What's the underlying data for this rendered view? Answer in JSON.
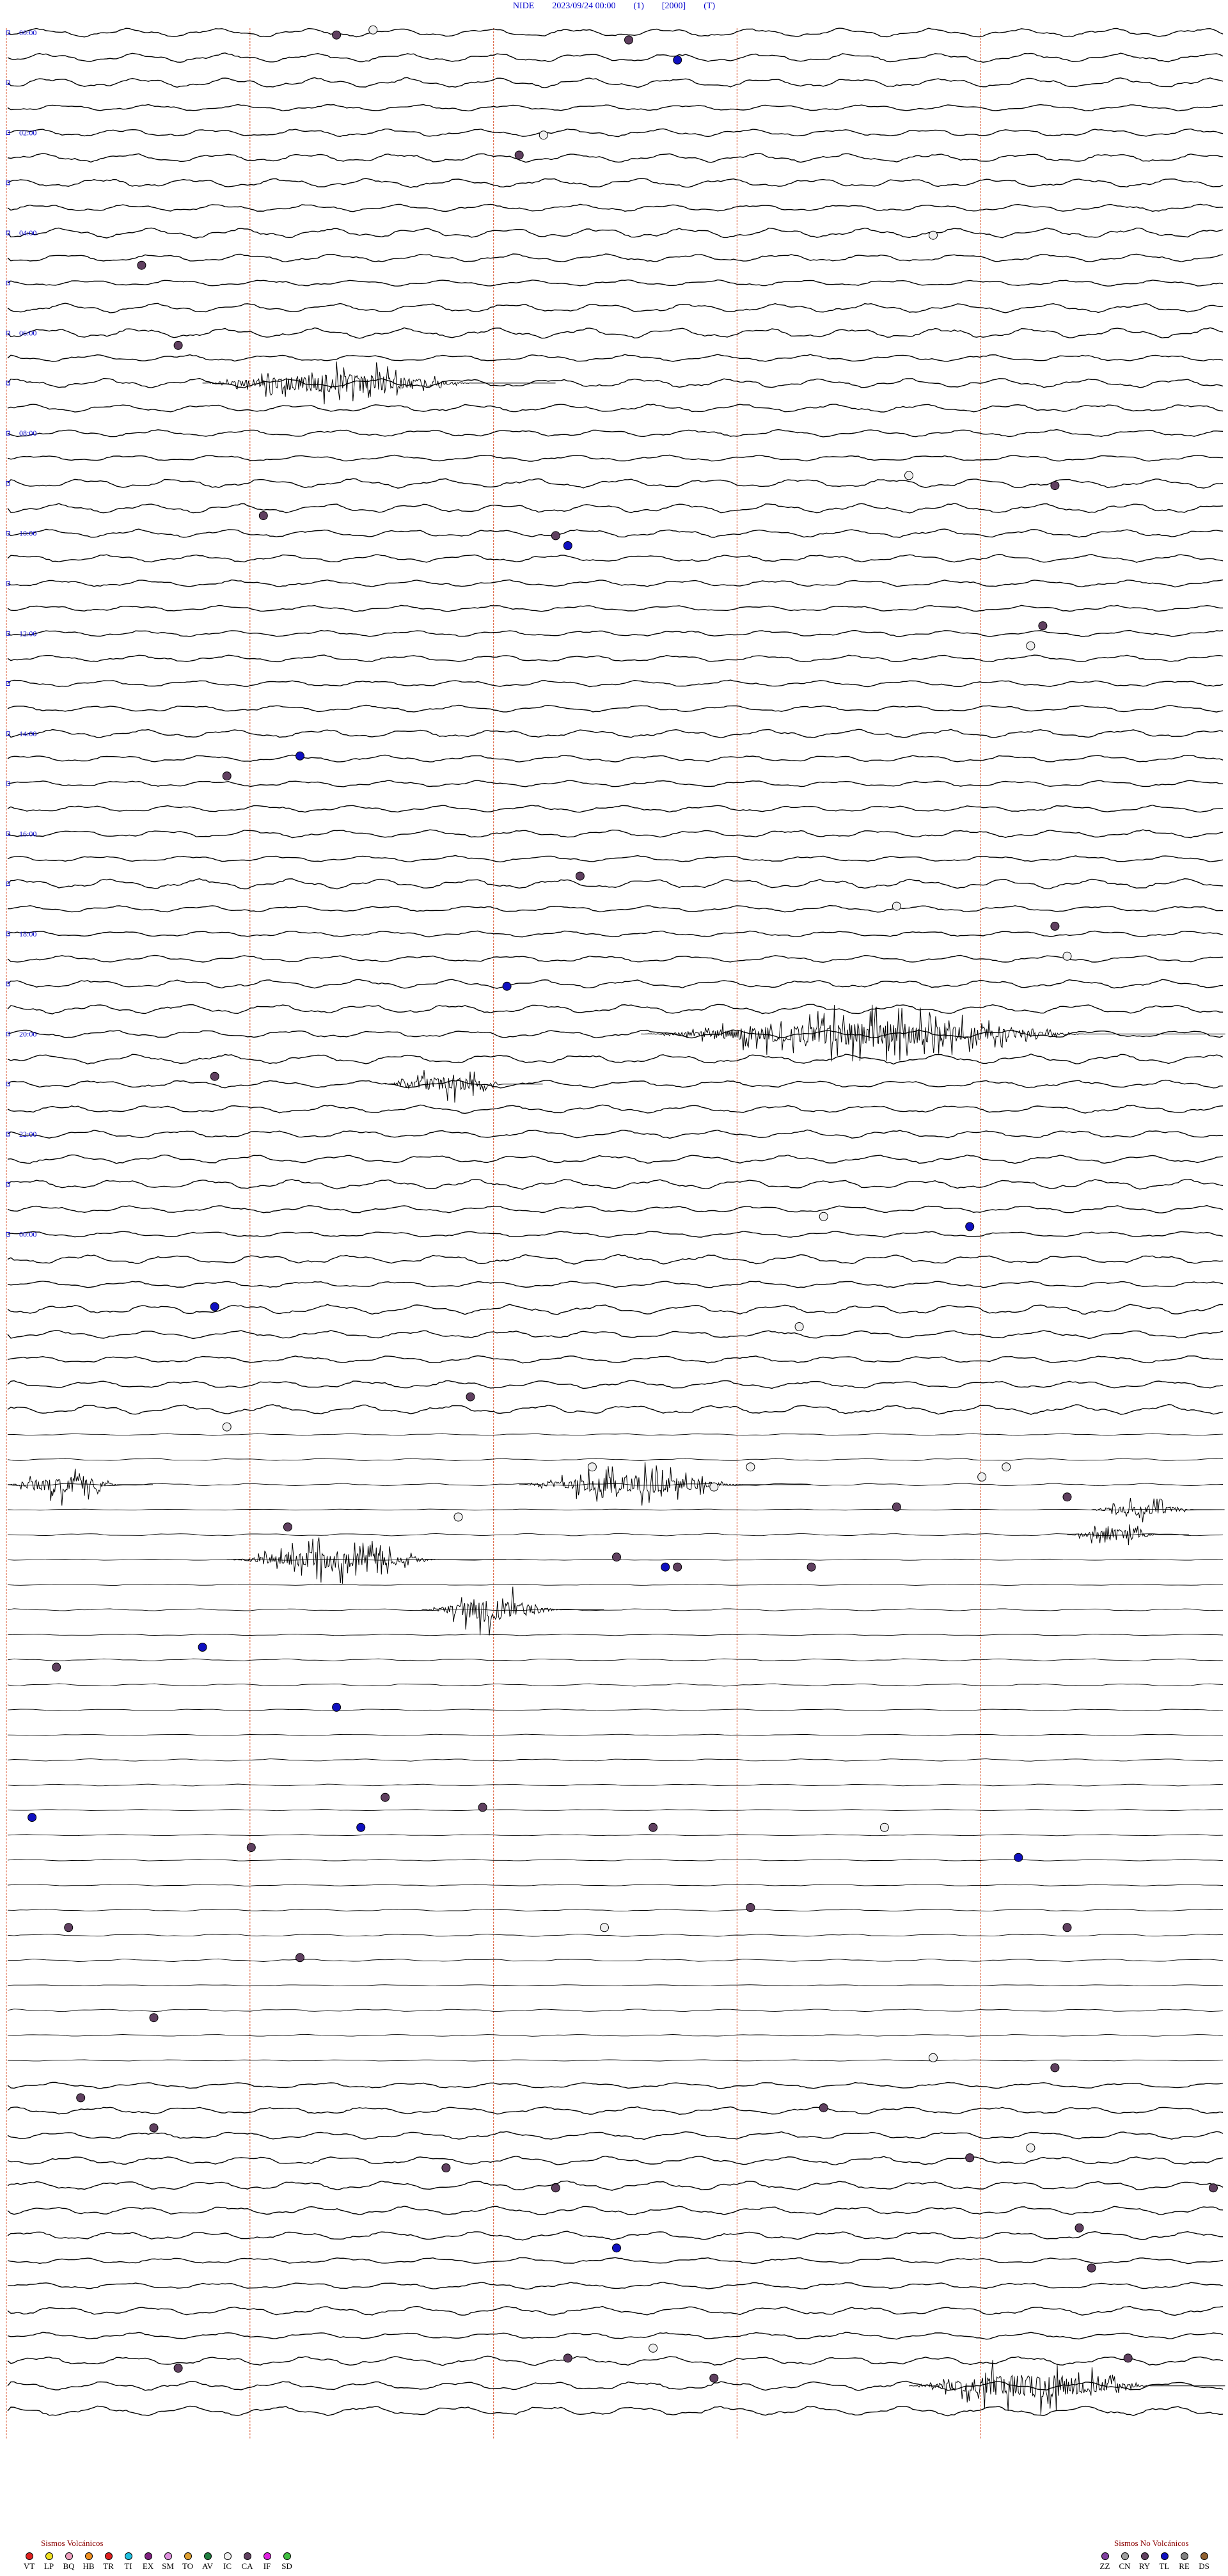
{
  "header": {
    "station": "NIDE",
    "datetime": "2023/09/24 00:00",
    "channel": "(1)",
    "gain": "[2000]",
    "scale": "(T)"
  },
  "colors": {
    "hour_label": "#0000cc",
    "trace": "#000000",
    "minute_guides": "#e07050",
    "legend_title": "#8b0000"
  },
  "chart_data": {
    "type": "helicorder",
    "start": "2023/09/24 00:00",
    "hours": 24,
    "traces_per_hour": 4,
    "hour_labels": [
      "00:00",
      "02:00",
      "04:00",
      "06:00",
      "08:00",
      "10:00",
      "12:00",
      "14:00",
      "16:00",
      "18:00",
      "20:00",
      "22:00",
      "00:00"
    ],
    "minute_guides_fraction": [
      0.0,
      0.2,
      0.4,
      0.6,
      0.8
    ],
    "trace_amplitude_segments": [
      {
        "hours": [
          0,
          14
        ],
        "level": "high"
      },
      {
        "hours": [
          14,
          20.5
        ],
        "level": "low"
      },
      {
        "hours": [
          20.5,
          24
        ],
        "level": "high"
      }
    ],
    "bursts": [
      {
        "trace": 14,
        "from": 0.16,
        "to": 0.45,
        "amp": 40
      },
      {
        "trace": 40,
        "from": 0.52,
        "to": 1.0,
        "amp": 48
      },
      {
        "trace": 42,
        "from": 0.31,
        "to": 0.44,
        "amp": 30
      },
      {
        "trace": 58,
        "from": 0.0,
        "to": 0.12,
        "amp": 36
      },
      {
        "trace": 58,
        "from": 0.42,
        "to": 0.66,
        "amp": 40
      },
      {
        "trace": 59,
        "from": 0.89,
        "to": 1.0,
        "amp": 22
      },
      {
        "trace": 60,
        "from": 0.87,
        "to": 0.97,
        "amp": 24
      },
      {
        "trace": 61,
        "from": 0.18,
        "to": 0.41,
        "amp": 38
      },
      {
        "trace": 63,
        "from": 0.34,
        "to": 0.49,
        "amp": 44
      },
      {
        "trace": 94,
        "from": 0.74,
        "to": 1.0,
        "amp": 50
      }
    ],
    "event_markers": [
      {
        "hour": 0.1,
        "pos": 0.27,
        "type": "CA"
      },
      {
        "hour": 0.05,
        "pos": 0.3,
        "type": "IC"
      },
      {
        "hour": 0.15,
        "pos": 0.51,
        "type": "CA"
      },
      {
        "hour": 0.35,
        "pos": 0.55,
        "type": "TL"
      },
      {
        "hour": 1.1,
        "pos": 0.44,
        "type": "IC"
      },
      {
        "hour": 1.3,
        "pos": 0.42,
        "type": "CA"
      },
      {
        "hour": 2.1,
        "pos": 0.76,
        "type": "IC"
      },
      {
        "hour": 2.4,
        "pos": 0.11,
        "type": "CA"
      },
      {
        "hour": 3.2,
        "pos": 0.14,
        "type": "CA"
      },
      {
        "hour": 4.5,
        "pos": 0.74,
        "type": "IC"
      },
      {
        "hour": 4.6,
        "pos": 0.86,
        "type": "CA"
      },
      {
        "hour": 4.9,
        "pos": 0.21,
        "type": "CA"
      },
      {
        "hour": 5.1,
        "pos": 0.45,
        "type": "CA"
      },
      {
        "hour": 5.2,
        "pos": 0.46,
        "type": "TL"
      },
      {
        "hour": 6.0,
        "pos": 0.85,
        "type": "CA"
      },
      {
        "hour": 6.2,
        "pos": 0.84,
        "type": "IC"
      },
      {
        "hour": 7.3,
        "pos": 0.24,
        "type": "TL"
      },
      {
        "hour": 7.5,
        "pos": 0.18,
        "type": "CA"
      },
      {
        "hour": 8.5,
        "pos": 0.47,
        "type": "CA"
      },
      {
        "hour": 8.8,
        "pos": 0.73,
        "type": "IC"
      },
      {
        "hour": 9.0,
        "pos": 0.86,
        "type": "CA"
      },
      {
        "hour": 9.3,
        "pos": 0.87,
        "type": "IC"
      },
      {
        "hour": 9.6,
        "pos": 0.41,
        "type": "TL"
      },
      {
        "hour": 10.5,
        "pos": 0.17,
        "type": "CA"
      },
      {
        "hour": 11.9,
        "pos": 0.67,
        "type": "IC"
      },
      {
        "hour": 12.0,
        "pos": 0.79,
        "type": "TL"
      },
      {
        "hour": 12.8,
        "pos": 0.17,
        "type": "TL"
      },
      {
        "hour": 13.0,
        "pos": 0.65,
        "type": "IC"
      },
      {
        "hour": 13.7,
        "pos": 0.38,
        "type": "CA"
      },
      {
        "hour": 14.0,
        "pos": 0.18,
        "type": "IC"
      },
      {
        "hour": 14.4,
        "pos": 0.48,
        "type": "IC"
      },
      {
        "hour": 14.4,
        "pos": 0.61,
        "type": "IC"
      },
      {
        "hour": 14.5,
        "pos": 0.8,
        "type": "IC"
      },
      {
        "hour": 14.4,
        "pos": 0.82,
        "type": "IC"
      },
      {
        "hour": 14.6,
        "pos": 0.58,
        "type": "IC"
      },
      {
        "hour": 14.7,
        "pos": 0.87,
        "type": "CA"
      },
      {
        "hour": 14.8,
        "pos": 0.73,
        "type": "CA"
      },
      {
        "hour": 14.9,
        "pos": 0.37,
        "type": "IC"
      },
      {
        "hour": 15.0,
        "pos": 0.23,
        "type": "CA"
      },
      {
        "hour": 15.3,
        "pos": 0.5,
        "type": "CA"
      },
      {
        "hour": 15.4,
        "pos": 0.55,
        "type": "CA"
      },
      {
        "hour": 15.4,
        "pos": 0.66,
        "type": "CA"
      },
      {
        "hour": 15.4,
        "pos": 0.54,
        "type": "TL"
      },
      {
        "hour": 16.2,
        "pos": 0.16,
        "type": "TL"
      },
      {
        "hour": 16.4,
        "pos": 0.04,
        "type": "CA"
      },
      {
        "hour": 16.8,
        "pos": 0.27,
        "type": "TL"
      },
      {
        "hour": 17.7,
        "pos": 0.31,
        "type": "CA"
      },
      {
        "hour": 17.8,
        "pos": 0.39,
        "type": "CA"
      },
      {
        "hour": 17.9,
        "pos": 0.02,
        "type": "TL"
      },
      {
        "hour": 18.0,
        "pos": 0.29,
        "type": "TL"
      },
      {
        "hour": 18.0,
        "pos": 0.72,
        "type": "IC"
      },
      {
        "hour": 18.0,
        "pos": 0.53,
        "type": "CA"
      },
      {
        "hour": 18.2,
        "pos": 0.2,
        "type": "CA"
      },
      {
        "hour": 18.3,
        "pos": 0.83,
        "type": "TL"
      },
      {
        "hour": 18.8,
        "pos": 0.61,
        "type": "CA"
      },
      {
        "hour": 19.0,
        "pos": 0.49,
        "type": "IC"
      },
      {
        "hour": 19.0,
        "pos": 0.05,
        "type": "CA"
      },
      {
        "hour": 19.0,
        "pos": 0.87,
        "type": "CA"
      },
      {
        "hour": 19.3,
        "pos": 0.24,
        "type": "CA"
      },
      {
        "hour": 19.9,
        "pos": 0.12,
        "type": "CA"
      },
      {
        "hour": 20.3,
        "pos": 0.76,
        "type": "IC"
      },
      {
        "hour": 20.4,
        "pos": 0.86,
        "type": "CA"
      },
      {
        "hour": 20.7,
        "pos": 0.06,
        "type": "CA"
      },
      {
        "hour": 20.8,
        "pos": 0.67,
        "type": "CA"
      },
      {
        "hour": 21.0,
        "pos": 0.12,
        "type": "CA"
      },
      {
        "hour": 21.2,
        "pos": 0.84,
        "type": "IC"
      },
      {
        "hour": 21.3,
        "pos": 0.79,
        "type": "CA"
      },
      {
        "hour": 21.4,
        "pos": 0.36,
        "type": "CA"
      },
      {
        "hour": 21.6,
        "pos": 0.45,
        "type": "CA"
      },
      {
        "hour": 21.6,
        "pos": 0.99,
        "type": "CA"
      },
      {
        "hour": 22.2,
        "pos": 0.5,
        "type": "TL"
      },
      {
        "hour": 22.0,
        "pos": 0.88,
        "type": "CA"
      },
      {
        "hour": 22.4,
        "pos": 0.89,
        "type": "CA"
      },
      {
        "hour": 23.2,
        "pos": 0.53,
        "type": "IC"
      },
      {
        "hour": 23.3,
        "pos": 0.46,
        "type": "CA"
      },
      {
        "hour": 23.4,
        "pos": 0.14,
        "type": "CA"
      },
      {
        "hour": 23.3,
        "pos": 0.92,
        "type": "CA"
      },
      {
        "hour": 23.5,
        "pos": 0.58,
        "type": "CA"
      }
    ]
  },
  "legend_volcanic": {
    "title": "Sismos Volcánicos",
    "items": [
      {
        "code": "VT",
        "color": "#e02020"
      },
      {
        "code": "LP",
        "color": "#f0e020"
      },
      {
        "code": "BQ",
        "color": "#f0a0c0"
      },
      {
        "code": "HB",
        "color": "#f09020"
      },
      {
        "code": "TR",
        "color": "#e02020"
      },
      {
        "code": "TI",
        "color": "#20c0e0"
      },
      {
        "code": "EX",
        "color": "#802080"
      },
      {
        "code": "SM",
        "color": "#e090e0"
      },
      {
        "code": "TO",
        "color": "#e0a030"
      },
      {
        "code": "AV",
        "color": "#208040"
      },
      {
        "code": "IC",
        "color": "#f0f0f0"
      },
      {
        "code": "CA",
        "color": "#604060"
      },
      {
        "code": "IF",
        "color": "#e020e0"
      },
      {
        "code": "SD",
        "color": "#40c040"
      }
    ]
  },
  "legend_nonvolcanic": {
    "title": "Sismos No Volcánicos",
    "items": [
      {
        "code": "ZZ",
        "color": "#8040a0"
      },
      {
        "code": "CN",
        "color": "#a0a0a0"
      },
      {
        "code": "RY",
        "color": "#604060"
      },
      {
        "code": "TL",
        "color": "#1010c0"
      },
      {
        "code": "RE",
        "color": "#808080"
      },
      {
        "code": "DS",
        "color": "#906030"
      }
    ]
  }
}
